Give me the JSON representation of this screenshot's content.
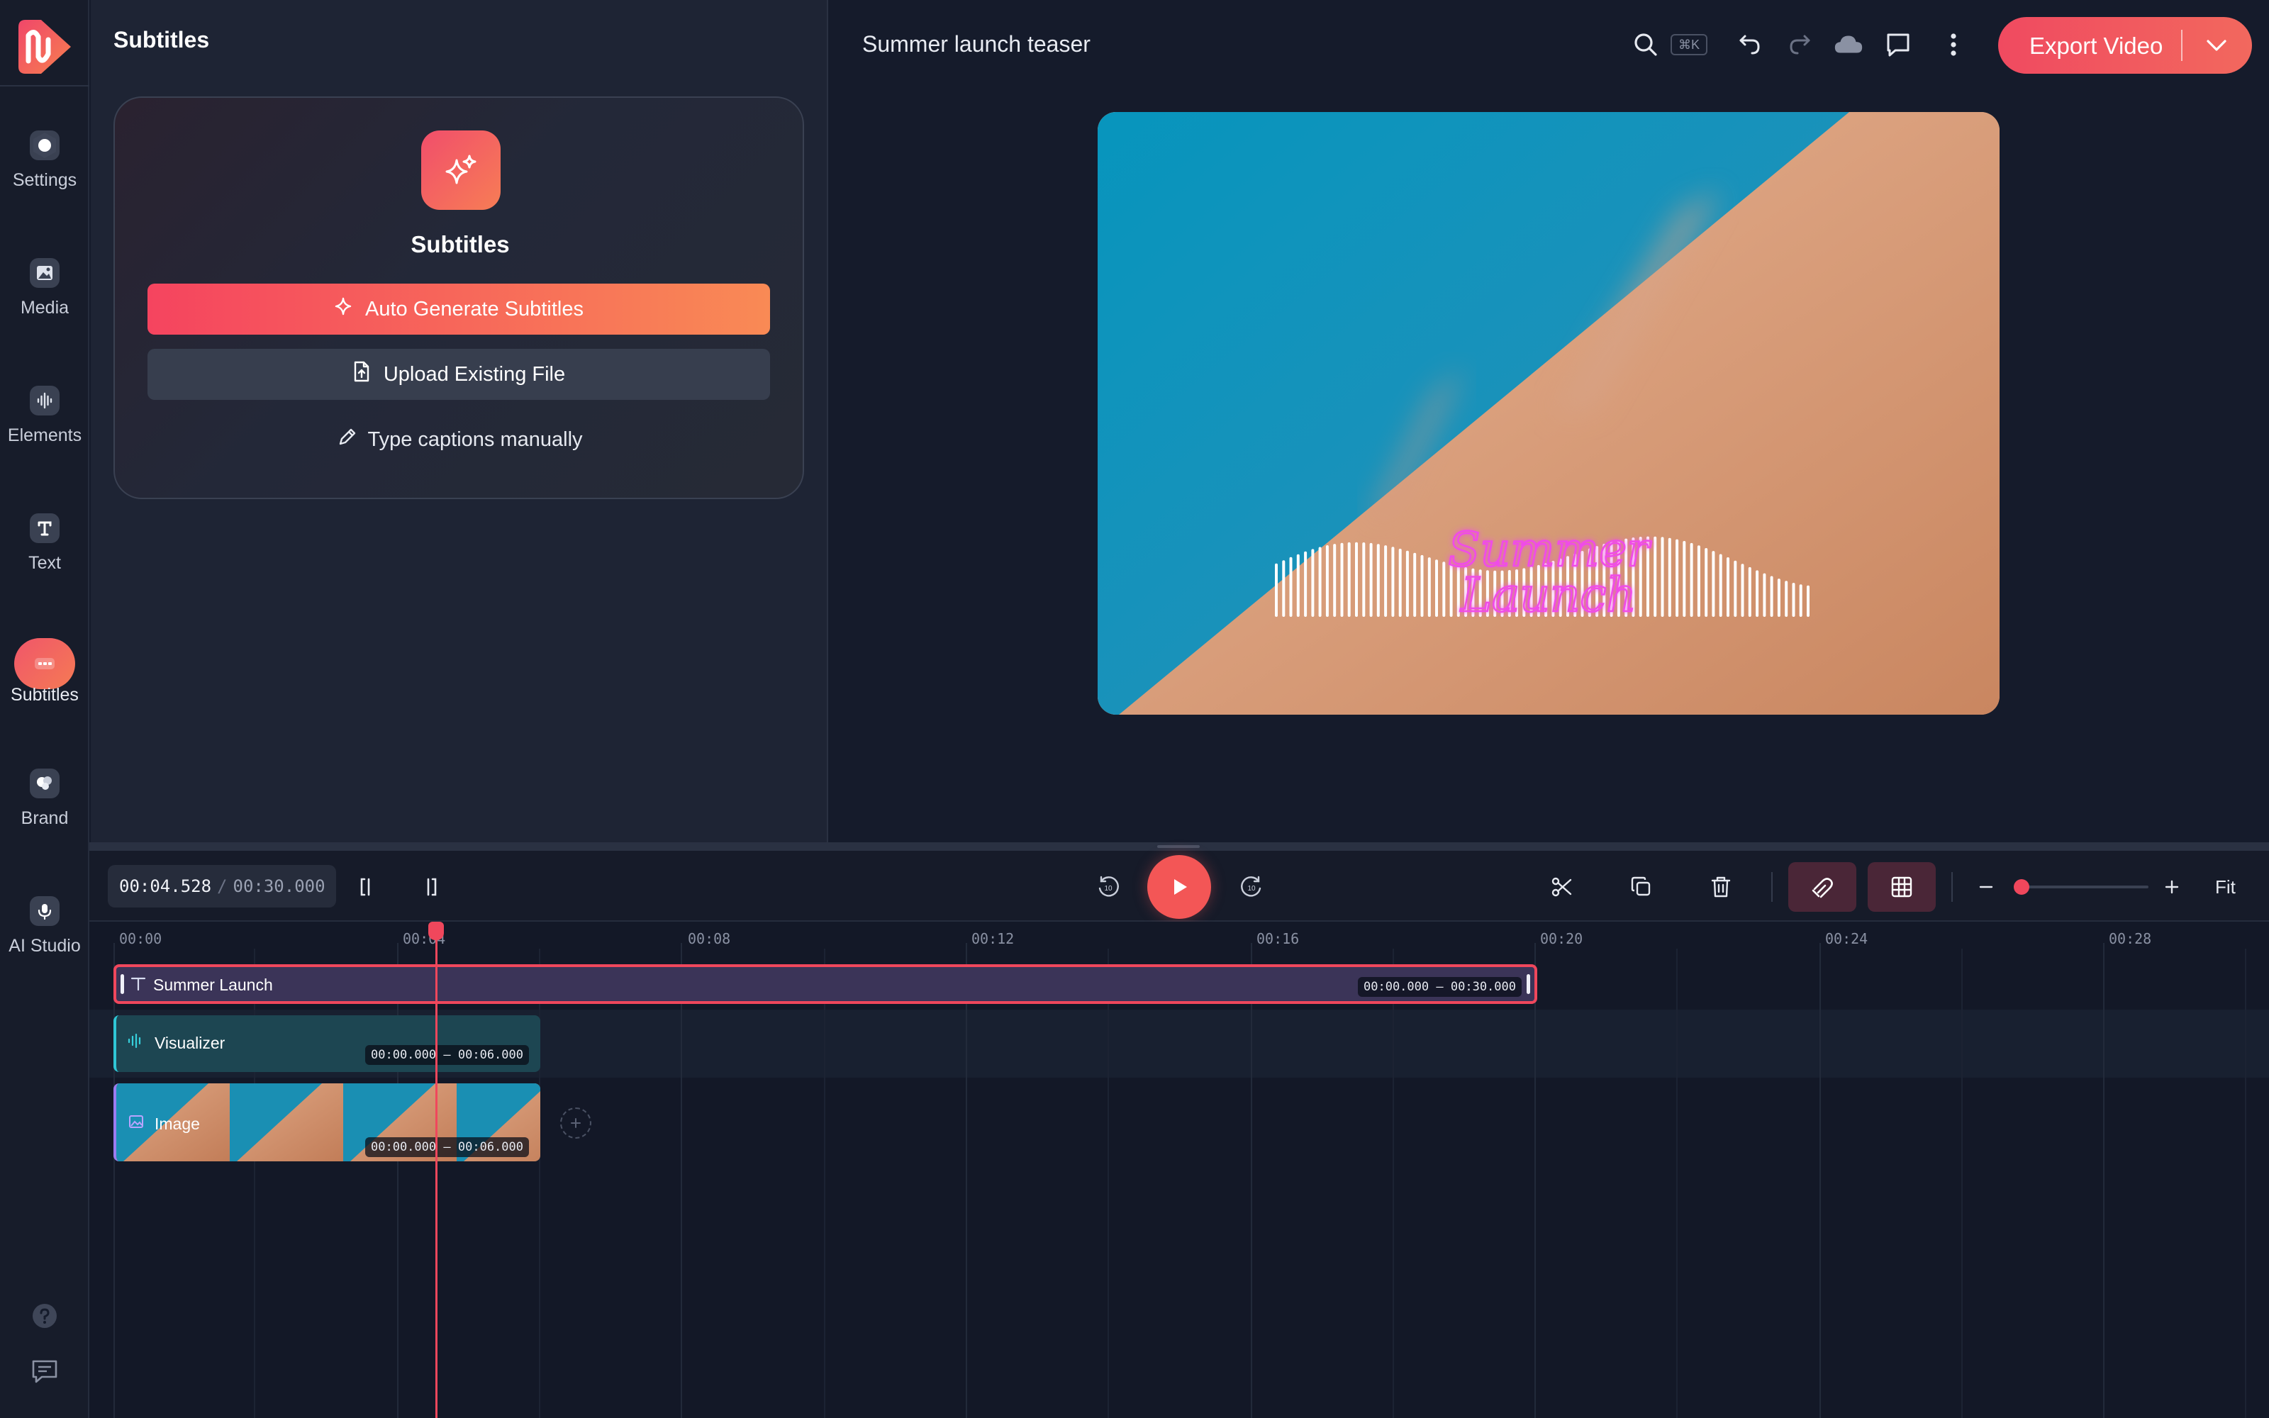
{
  "rail": {
    "items": [
      {
        "label": "Settings",
        "icon": "hexagon-icon"
      },
      {
        "label": "Media",
        "icon": "image-icon"
      },
      {
        "label": "Elements",
        "icon": "waveform-icon"
      },
      {
        "label": "Text",
        "icon": "text-icon"
      },
      {
        "label": "Subtitles",
        "icon": "captions-icon",
        "active": true
      },
      {
        "label": "Brand",
        "icon": "palette-icon"
      },
      {
        "label": "AI Studio",
        "icon": "microphone-icon"
      }
    ],
    "bottom": [
      "help-icon",
      "feedback-icon"
    ]
  },
  "panel": {
    "title": "Subtitles",
    "card_title": "Subtitles",
    "auto_generate": "Auto Generate Subtitles",
    "upload": "Upload Existing File",
    "manual": "Type captions manually"
  },
  "header": {
    "project_title": "Summer launch teaser",
    "shortcut": "⌘K",
    "export_label": "Export Video"
  },
  "preview": {
    "caption_line1": "Summer",
    "caption_line2": "Launch"
  },
  "timeline": {
    "current_time": "00:04.528",
    "separator": "/",
    "total_time": "00:30.000",
    "fit_label": "Fit",
    "zoom_level": 0,
    "playhead_seconds": 4.528,
    "ruler": [
      "00:00",
      "00:04",
      "00:08",
      "00:12",
      "00:16",
      "00:20",
      "00:24",
      "00:28"
    ],
    "tracks": [
      {
        "name": "Summer Launch",
        "range_start": "00:00.000",
        "range_dash": "–",
        "range_end": "00:30.000",
        "type": "text"
      },
      {
        "name": "Visualizer",
        "range_start": "00:00.000",
        "range_dash": "–",
        "range_end": "00:06.000",
        "type": "visualizer"
      },
      {
        "name": "Image",
        "range_start": "00:00.000",
        "range_dash": "–",
        "range_end": "00:06.000",
        "type": "image"
      }
    ]
  },
  "colors": {
    "accent": "#f0475c",
    "accent_gradient_end": "#f98a55",
    "text_clip": "#3b3458",
    "visualizer_clip": "#1d4652",
    "caption_neon": "#e43cf0"
  }
}
